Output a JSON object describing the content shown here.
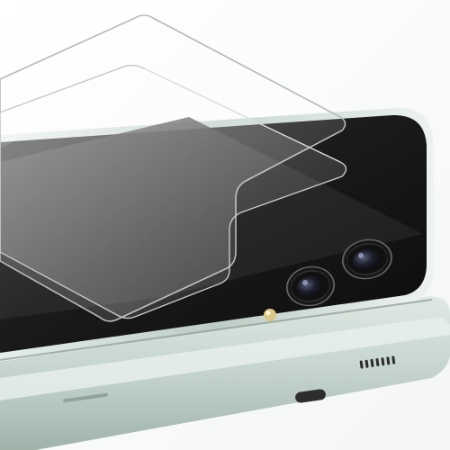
{
  "image": {
    "subject": "",
    "colors": {
      "background": "#ffffff",
      "phone_body": "#c9d8d2",
      "phone_frame_edge": "#a9bdb5",
      "phone_black_glass": "#151515",
      "screen_gray": "#2a2a2a",
      "glass_protector_edge": "#b5bab8",
      "camera_ring": "#1a1a1a",
      "camera_lens": "#2b2b3a",
      "led_flash": "#d8c78a",
      "port_dark": "#2d2d2d"
    }
  }
}
